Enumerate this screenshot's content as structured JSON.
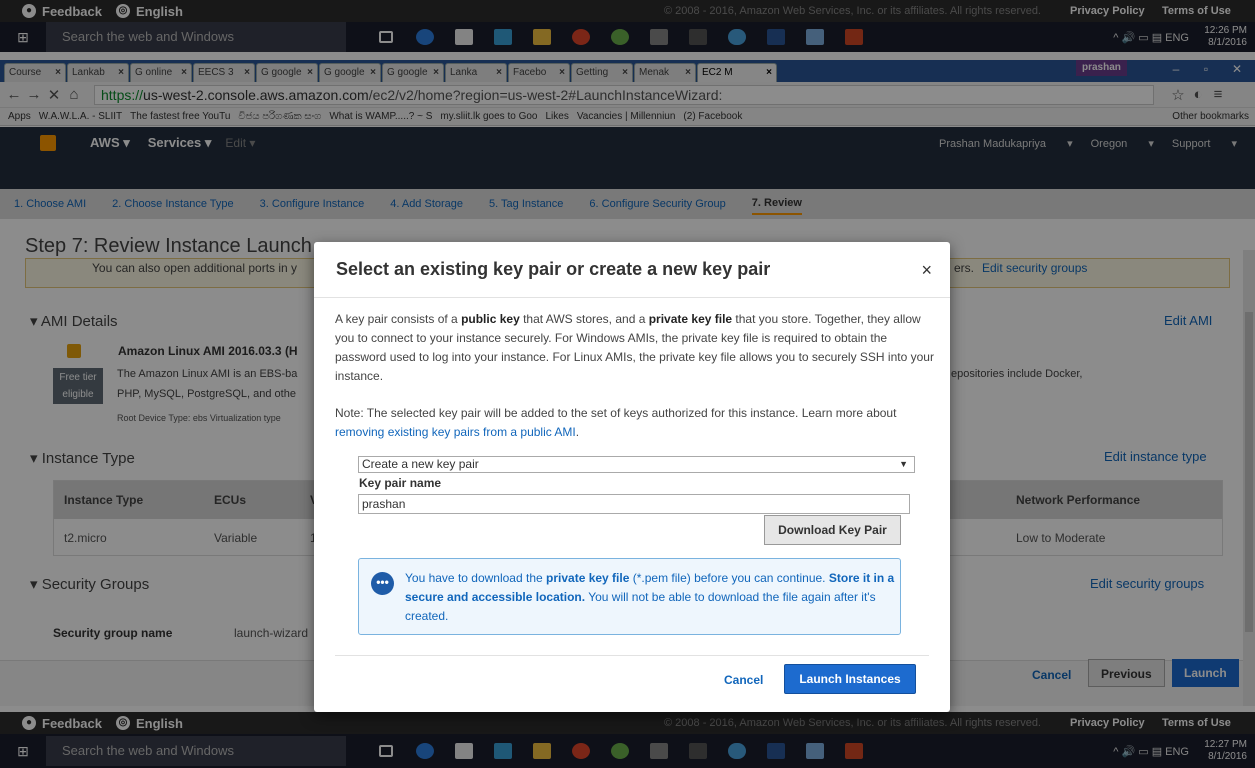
{
  "feedback_bar": {
    "feedback": "Feedback",
    "language": "English",
    "copyright": "© 2008 - 2016, Amazon Web Services, Inc. or its affiliates. All rights reserved.",
    "privacy": "Privacy Policy",
    "terms": "Terms of Use"
  },
  "taskbar_top": {
    "search_placeholder": "Search the web and Windows",
    "lang": "ENG",
    "time": "12:26 PM",
    "date": "8/1/2016"
  },
  "taskbar_bottom": {
    "search_placeholder": "Search the web and Windows",
    "lang": "ENG",
    "time": "12:27 PM",
    "date": "8/1/2016"
  },
  "browser": {
    "tabs": [
      "Course",
      "Lankab",
      "G online",
      "EECS 3",
      "G google",
      "G google",
      "G google",
      "Lanka",
      "Facebo",
      "Getting",
      "Menak",
      "EC2 M"
    ],
    "profile": "prashan",
    "url_https": "https://",
    "url_host": "us-west-2.console.aws.amazon.com",
    "url_path": "/ec2/v2/home?region=us-west-2#LaunchInstanceWizard:",
    "bookmarks": [
      "Apps",
      "W.A.W.L.A. - SLIIT",
      "The fastest free YouTu",
      "විජය පරිගණක සංග",
      "What is WAMP.....? ~ S",
      "my.sliit.lk goes to Goo",
      "Likes",
      "Vacancies | Millenniun",
      "(2) Facebook"
    ],
    "other_bookmarks": "Other bookmarks"
  },
  "aws": {
    "brand": "AWS",
    "services": "Services",
    "edit": "Edit",
    "user": "Prashan Madukapriya",
    "region": "Oregon",
    "support": "Support"
  },
  "wizard_steps": [
    "1. Choose AMI",
    "2. Choose Instance Type",
    "3. Configure Instance",
    "4. Add Storage",
    "5. Tag Instance",
    "6. Configure Security Group",
    "7. Review"
  ],
  "page": {
    "title": "Step 7: Review Instance Launch",
    "info_text": "You can also open additional ports in y",
    "info_tail": "ers.",
    "edit_security_groups": "Edit security groups",
    "ami_heading": "AMI Details",
    "edit_ami": "Edit AMI",
    "ami_name": "Amazon Linux AMI 2016.03.3 (H",
    "ami_desc": "The Amazon Linux AMI is an EBS-ba",
    "ami_desc2": "PHP, MySQL, PostgreSQL, and othe",
    "ami_desc_tail": "epositories include Docker,",
    "free_tier": "Free tier",
    "eligible": "eligible",
    "ami_meta": "Root Device Type: ebs    Virtualization type",
    "instance_heading": "Instance Type",
    "edit_instance": "Edit instance type",
    "table_headers": [
      "Instance Type",
      "ECUs",
      "V",
      "Network Performance"
    ],
    "table_row": [
      "t2.micro",
      "Variable",
      "1",
      "Low to Moderate"
    ],
    "sg_heading": "Security Groups",
    "edit_sg": "Edit security groups",
    "sg_name_label": "Security group name",
    "sg_name_value": "launch-wizard",
    "cancel": "Cancel",
    "previous": "Previous",
    "launch": "Launch"
  },
  "modal": {
    "title": "Select an existing key pair or create a new key pair",
    "close": "×",
    "p1_a": "A key pair consists of a ",
    "p1_b": "public key",
    "p1_c": " that AWS stores, and a ",
    "p1_d": "private key file",
    "p1_e": " that you store. Together, they allow you to connect to your instance securely. For Windows AMIs, the private key file is required to obtain the password used to log into your instance. For Linux AMIs, the private key file allows you to securely SSH into your instance.",
    "p2_a": "Note: The selected key pair will be added to the set of keys authorized for this instance. Learn more about ",
    "p2_link": "removing existing key pairs from a public AMI",
    "p2_b": ".",
    "select_value": "Create a new key pair",
    "key_label": "Key pair name",
    "key_value": "prashan",
    "download": "Download Key Pair",
    "notice_a": "You have to download the ",
    "notice_b": "private key file",
    "notice_c": " (*.pem file) before you can continue. ",
    "notice_d": "Store it in a secure and accessible location.",
    "notice_e": " You will not be able to download the file again after it's created.",
    "cancel": "Cancel",
    "launch": "Launch Instances"
  }
}
